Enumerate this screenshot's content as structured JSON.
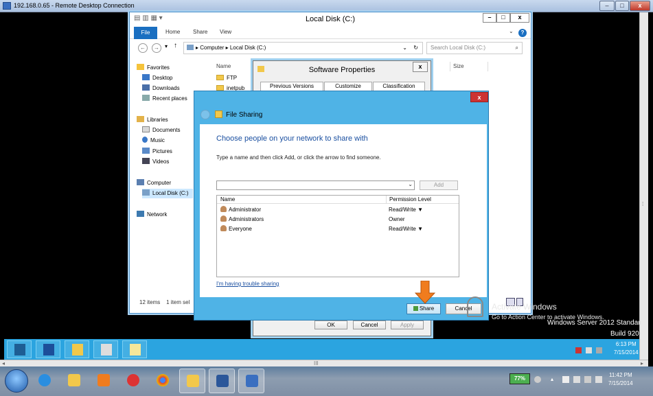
{
  "rdp": {
    "title": "192.168.0.65 - Remote Desktop Connection",
    "min": "–",
    "max": "□",
    "close": "x"
  },
  "explorer": {
    "title": "Local Disk (C:)",
    "ribbon_tabs": [
      "File",
      "Home",
      "Share",
      "View"
    ],
    "address": "Computer  ▸  Local Disk (C:)",
    "search_placeholder": "Search Local Disk (C:)",
    "nav": {
      "favorites": "Favorites",
      "desktop": "Desktop",
      "downloads": "Downloads",
      "recent": "Recent places",
      "libraries": "Libraries",
      "documents": "Documents",
      "music": "Music",
      "pictures": "Pictures",
      "videos": "Videos",
      "computer": "Computer",
      "local_disk": "Local Disk (C:)",
      "network": "Network"
    },
    "columns": {
      "name": "Name",
      "size": "Size"
    },
    "files": [
      "FTP",
      "inetpub"
    ],
    "status_items": "12 items",
    "status_selected": "1 item sel"
  },
  "software_properties": {
    "title": "Software Properties",
    "close": "x",
    "tabs": [
      "Previous Versions",
      "Customize",
      "Classification"
    ],
    "ok": "OK",
    "cancel": "Cancel",
    "apply": "Apply"
  },
  "file_sharing": {
    "title": "File Sharing",
    "close": "x",
    "heading": "Choose people on your network to share with",
    "instruction": "Type a name and then click Add, or click the arrow to find someone.",
    "add_button": "Add",
    "columns": {
      "name": "Name",
      "permission": "Permission Level"
    },
    "users": [
      {
        "name": "Administrator",
        "permission": "Read/Write ▼"
      },
      {
        "name": "Administrators",
        "permission": "Owner"
      },
      {
        "name": "Everyone",
        "permission": "Read/Write ▼"
      }
    ],
    "trouble_link": "I'm having trouble sharing",
    "share_button": "Share",
    "cancel_button": "Cancel"
  },
  "watermark": {
    "activate": "Activate Windows",
    "go_to": "Go to Action Center to activate Windows.",
    "edition": "Windows Server 2012 Standar",
    "build": "Build 920"
  },
  "remote_taskbar": {
    "time": "6:13 PM",
    "date": "7/15/2014"
  },
  "local_taskbar": {
    "battery": "77%",
    "time": "11:42 PM",
    "date": "7/15/2014"
  },
  "scrollbar_grip": "⁞",
  "scrollbar_grip_h": "III",
  "colors": {
    "accent": "#2ba4e0",
    "dialog_frame": "#4fb3e6",
    "link": "#1a4fa0",
    "arrow": "#f07c1e"
  }
}
